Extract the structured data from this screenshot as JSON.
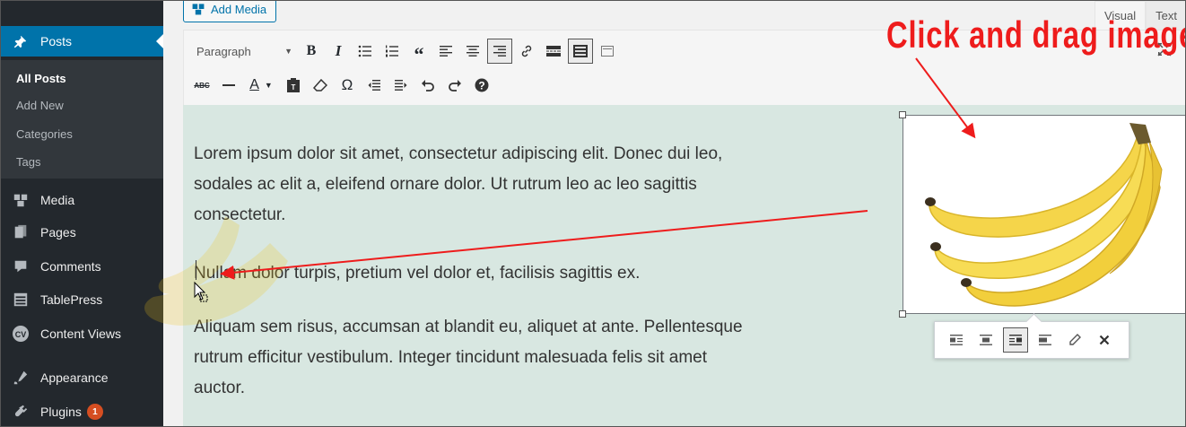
{
  "sidebar": {
    "posts": "Posts",
    "submenu": [
      "All Posts",
      "Add New",
      "Categories",
      "Tags"
    ],
    "items": [
      {
        "label": "Media",
        "icon": "media-icon"
      },
      {
        "label": "Pages",
        "icon": "pages-icon"
      },
      {
        "label": "Comments",
        "icon": "comments-icon"
      },
      {
        "label": "TablePress",
        "icon": "tablepress-icon"
      },
      {
        "label": "Content Views",
        "icon": "content-views-icon"
      },
      {
        "label": "Appearance",
        "icon": "appearance-icon"
      },
      {
        "label": "Plugins",
        "icon": "plugins-icon"
      }
    ],
    "plugins_badge": "1",
    "content_views_icon_text": "CV",
    "accent": "#0073aa"
  },
  "editor": {
    "add_media": "Add Media",
    "tabs": {
      "visual": "Visual",
      "text": "Text"
    },
    "format_select": "Paragraph",
    "toolbar_row1": [
      "bold",
      "italic",
      "bulleted-list",
      "numbered-list",
      "blockquote",
      "align-left",
      "align-center",
      "align-right",
      "insert-link",
      "read-more",
      "toolbar-toggle",
      "distraction-free"
    ],
    "toolbar_row2": [
      "strikethrough",
      "horizontal-line",
      "text-color",
      "paste-as-text",
      "clear-formatting",
      "special-character",
      "decrease-indent",
      "increase-indent",
      "undo",
      "redo",
      "keyboard-shortcuts"
    ],
    "paragraphs": [
      [
        "Lorem ipsum dolor sit amet, consectetur adipiscing elit. Donec dui leo,",
        "sodales ac elit a, eleifend ornare dolor. Ut rutrum leo ac leo sagittis",
        "consectetur."
      ],
      [
        "Nullam dolor turpis, pretium vel dolor et, facilisis sagittis ex."
      ],
      [
        "Aliquam sem risus, accumsan at blandit eu, aliquet at ante. Pellentesque",
        "rutrum efficitur vestibulum. Integer tincidunt malesuada felis sit amet",
        "auctor."
      ]
    ],
    "image_toolbar": [
      "align-left",
      "align-center",
      "align-right",
      "no-alignment",
      "edit-image",
      "remove-image"
    ],
    "content_bg": "#d8e7e1"
  },
  "annotation": {
    "caption": "Click and drag image",
    "color": "#ee1c1c"
  }
}
